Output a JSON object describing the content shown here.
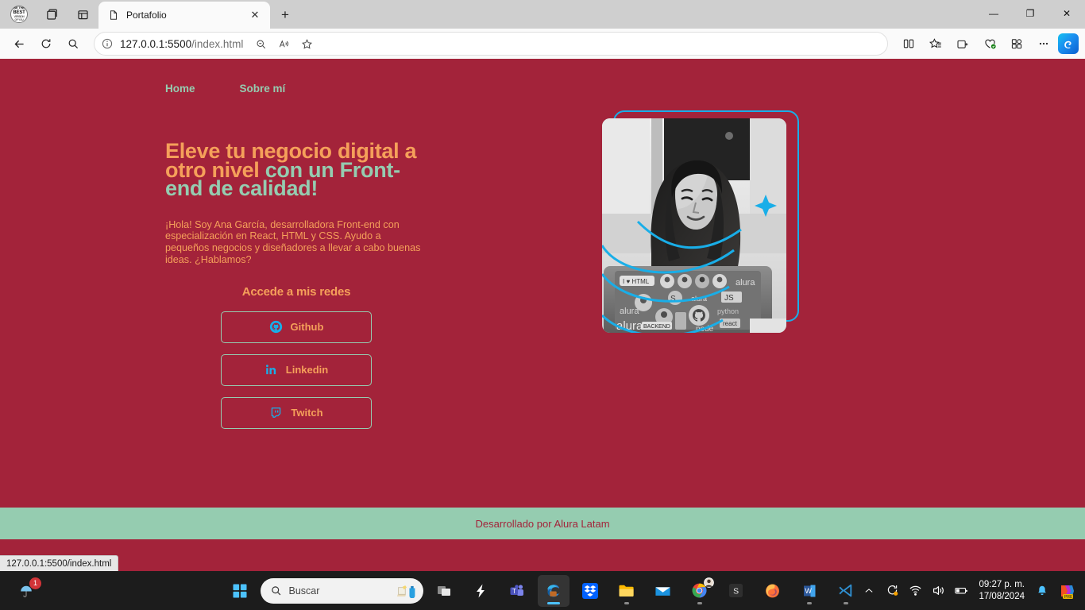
{
  "browser": {
    "profile_avatar_lines": [
      "BE THE",
      "BEST",
      "VERSION",
      "OF YOU"
    ],
    "tab": {
      "title": "Portafolio",
      "close_label": "✕"
    },
    "new_tab_label": "+",
    "window_controls": {
      "minimize": "—",
      "restore": "❐",
      "close": "✕"
    },
    "address": {
      "url_main": "127.0.0.1:5500",
      "url_path": "/index.html"
    },
    "status_bar_url": "127.0.0.1:5500/index.html"
  },
  "page": {
    "nav": [
      {
        "label": "Home"
      },
      {
        "label": "Sobre mí"
      }
    ],
    "title_part_orange": "Eleve tu negocio digital a otro nivel ",
    "title_part_green": "con un Front-end de calidad!",
    "subtitle": "¡Hola! Soy Ana García, desarrolladora Front-end con especialización en React, HTML y CSS. Ayudo a pequeños negocios y diseñadores a llevar a cabo buenas ideas. ¿Hablamos?",
    "redes_title": "Accede a mis redes",
    "buttons": [
      {
        "label": "Github",
        "icon": "github-icon"
      },
      {
        "label": "Linkedin",
        "icon": "linkedin-icon"
      },
      {
        "label": "Twitch",
        "icon": "twitch-icon"
      }
    ],
    "footer_text": "Desarrollado por Alura Latam",
    "colors": {
      "background": "#A3233A",
      "accent_orange": "#F5A05A",
      "accent_green": "#95CCB0",
      "accent_cyan": "#19AEE8"
    }
  },
  "taskbar": {
    "notification_badge": "1",
    "search_placeholder": "Buscar",
    "clock_time": "09:27 p. m.",
    "clock_date": "17/08/2024",
    "copilot_badge": "PRE"
  }
}
